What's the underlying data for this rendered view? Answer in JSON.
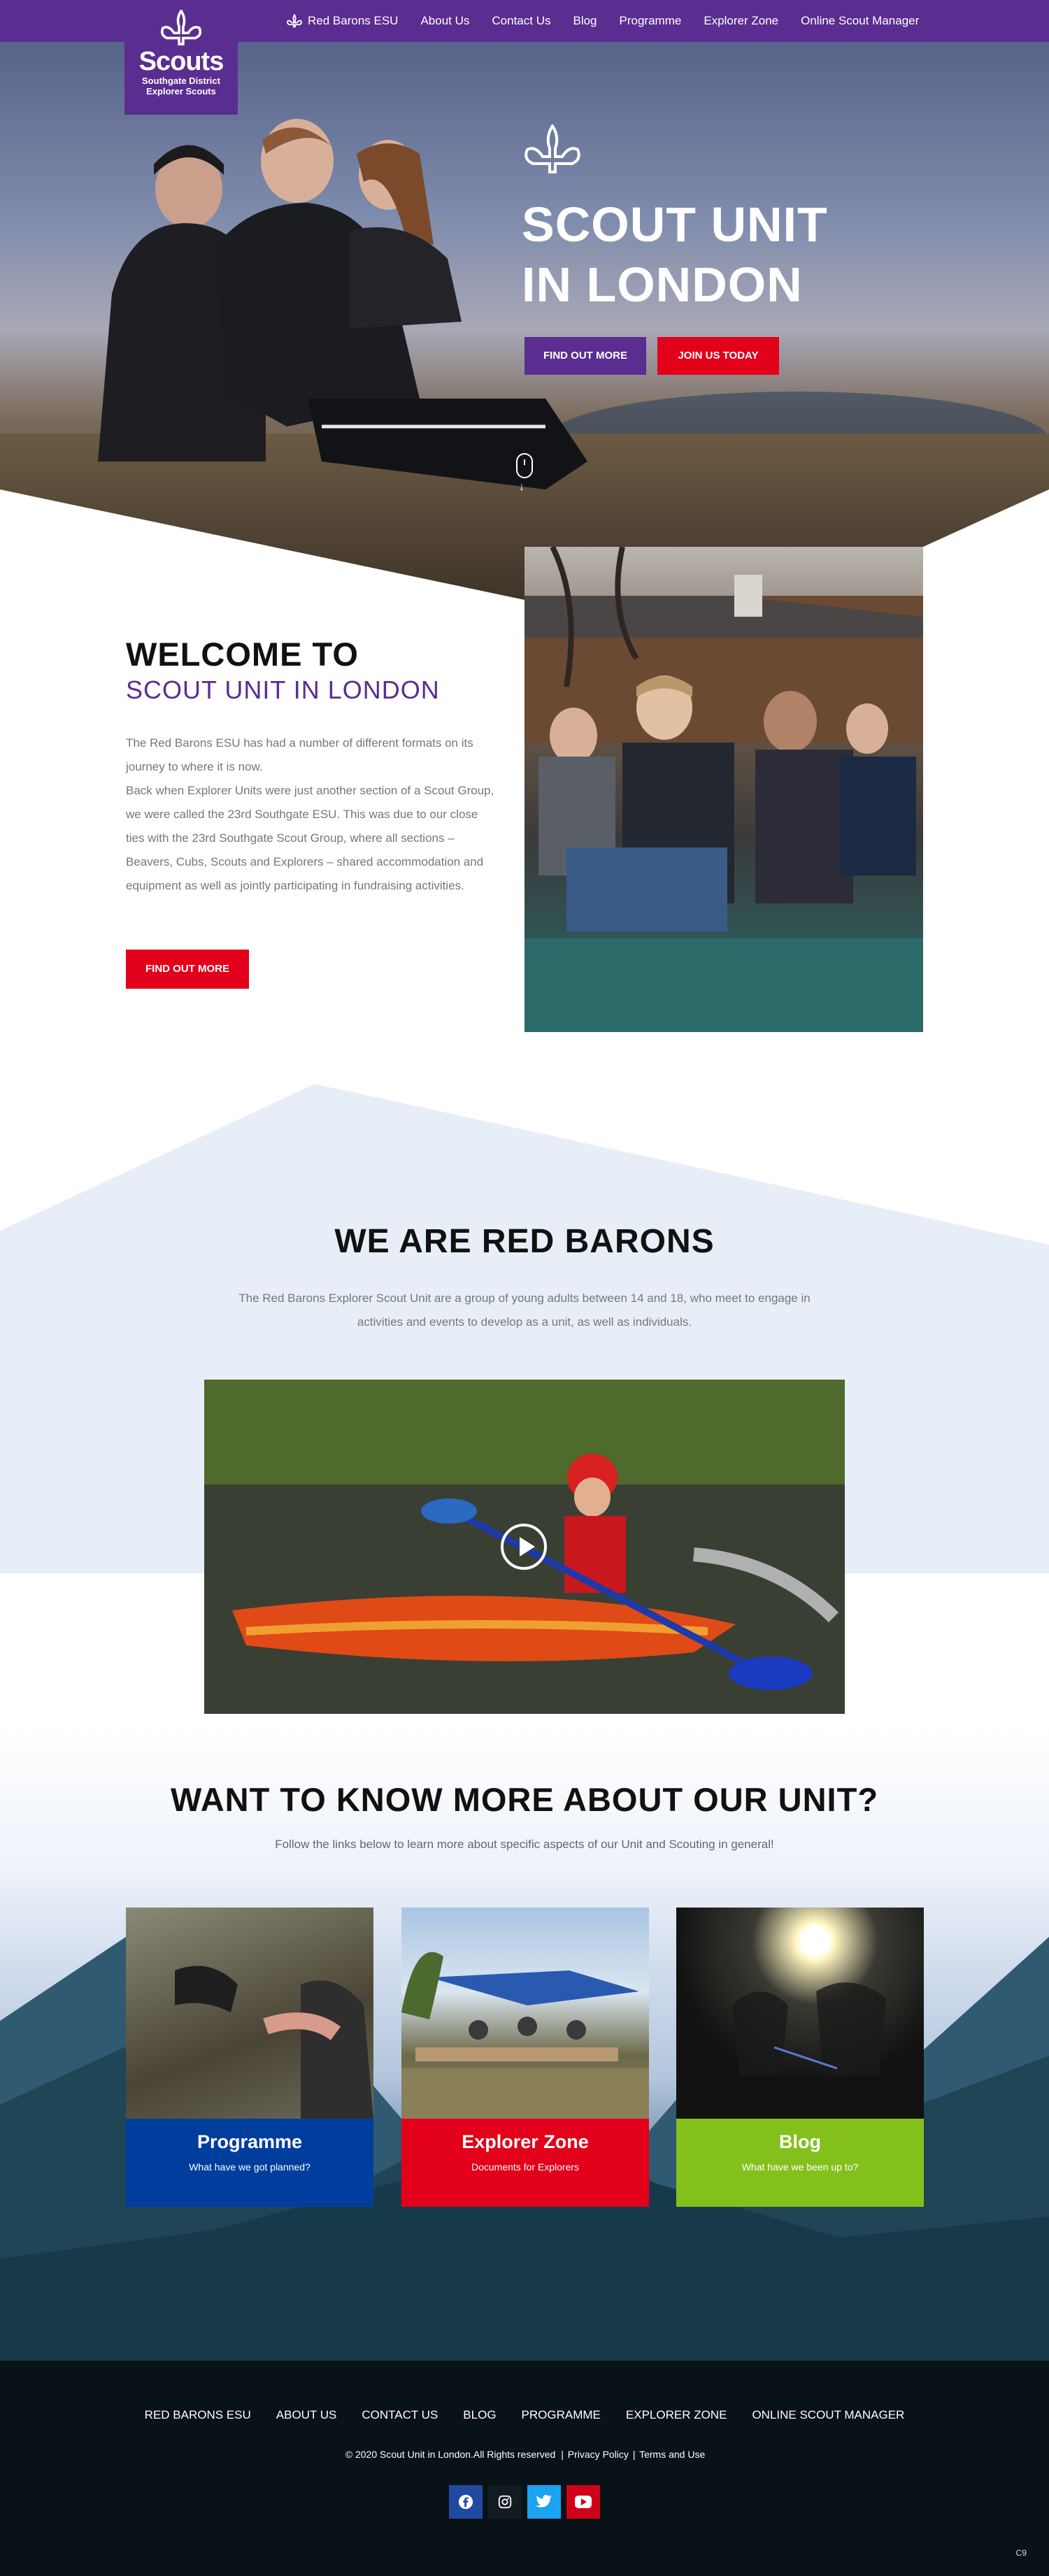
{
  "header": {
    "logo_brand": "Scouts",
    "logo_sub_1": "Southgate District",
    "logo_sub_2": "Explorer Scouts",
    "nav": [
      "Red Barons ESU",
      "About Us",
      "Contact Us",
      "Blog",
      "Programme",
      "Explorer Zone",
      "Online Scout Manager"
    ]
  },
  "hero": {
    "title_line1": "SCOUT UNIT",
    "title_line2": "IN LONDON",
    "btn_find_out": "FIND OUT MORE",
    "btn_join": "JOIN US TODAY"
  },
  "welcome": {
    "heading": "WELCOME TO",
    "subheading": "SCOUT UNIT IN LONDON",
    "para1": "The Red Barons ESU has had a number of different formats on its journey to where it is now.",
    "para2": "Back when Explorer Units were just another section of a Scout Group, we were called the 23rd Southgate ESU. This was due to our close ties with the 23rd Southgate Scout Group, where all sections – Beavers, Cubs, Scouts and Explorers – shared accommodation and equipment as well as jointly participating in fundraising activities.",
    "button": "FIND OUT MORE"
  },
  "red_barons": {
    "title": "WE ARE RED BARONS",
    "text": "The Red Barons Explorer Scout Unit are a group of young adults between 14 and 18, who meet to engage in activities and events to develop as a unit, as well as individuals."
  },
  "know_more": {
    "title": "WANT TO KNOW MORE ABOUT OUR UNIT?",
    "text": "Follow the links below to learn more about specific aspects of our Unit and Scouting in general!",
    "cards": [
      {
        "title": "Programme",
        "subtitle": "What have we got planned?",
        "color": "#003e9e"
      },
      {
        "title": "Explorer Zone",
        "subtitle": "Documents for Explorers",
        "color": "#e2001a"
      },
      {
        "title": "Blog",
        "subtitle": "What have we been up to?",
        "color": "#84c01c"
      }
    ]
  },
  "footer": {
    "nav": [
      "RED BARONS ESU",
      "ABOUT US",
      "CONTACT US",
      "BLOG",
      "PROGRAMME",
      "EXPLORER ZONE",
      "ONLINE SCOUT MANAGER"
    ],
    "copyright": "© 2020 Scout Unit in London.All Rights reserved",
    "privacy": "Privacy Policy",
    "terms": "Terms and Use",
    "socials": [
      "facebook-icon",
      "instagram-icon",
      "twitter-icon",
      "youtube-icon"
    ],
    "badge": "C9"
  },
  "colors": {
    "purple": "#5a2d91",
    "red": "#e2001a",
    "blue": "#003e9e",
    "green": "#84c01c",
    "footer": "#091216"
  }
}
